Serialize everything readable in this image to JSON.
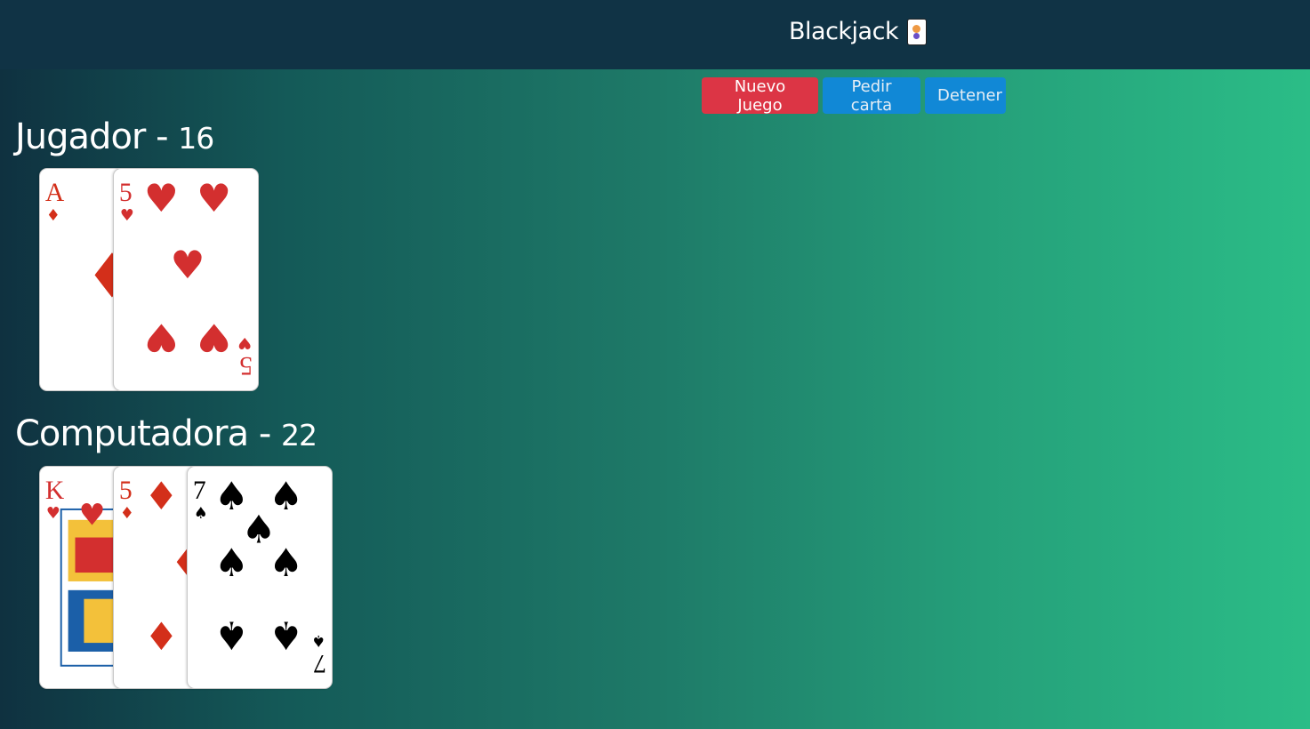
{
  "header": {
    "title": "Blackjack",
    "icon": "joker-card-icon"
  },
  "toolbar": {
    "new_game_label": "Nuevo Juego",
    "hit_label": "Pedir carta",
    "stand_label": "Detener"
  },
  "colors": {
    "danger": "#dc3545",
    "primary": "#1188d6",
    "header": "#103345"
  },
  "players": [
    {
      "name": "Jugador",
      "separator": "-",
      "score": "16",
      "cards": [
        {
          "rank": "A",
          "suit": "diamonds"
        },
        {
          "rank": "5",
          "suit": "hearts"
        }
      ]
    },
    {
      "name": "Computadora",
      "separator": "-",
      "score": "22",
      "cards": [
        {
          "rank": "K",
          "suit": "hearts"
        },
        {
          "rank": "5",
          "suit": "diamonds"
        },
        {
          "rank": "7",
          "suit": "spades"
        }
      ]
    }
  ]
}
